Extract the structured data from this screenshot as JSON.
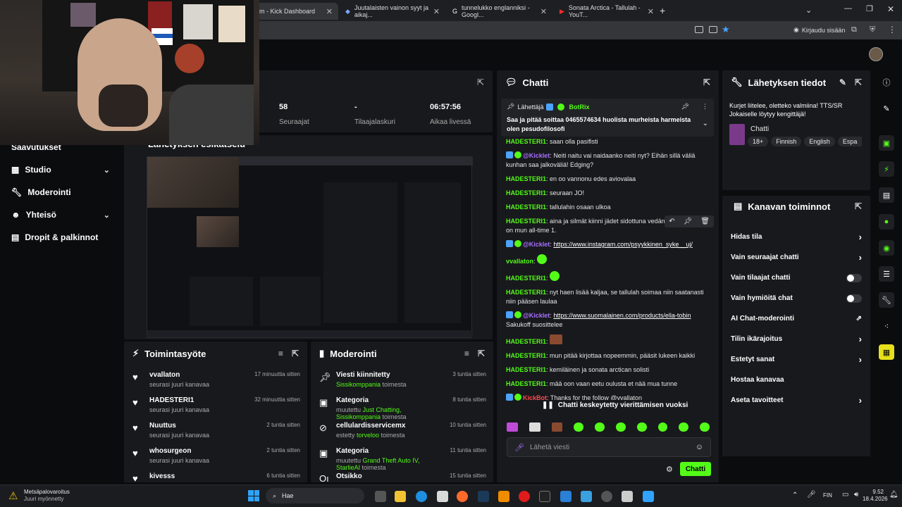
{
  "browser": {
    "tabs": [
      {
        "label": "m - Kick Dashboard",
        "active": true
      },
      {
        "label": "Juutalaisten vainon syyt ja aikaj..."
      },
      {
        "label": "tunnelukko englanniksi - Googl..."
      },
      {
        "label": "Sonata Arctica - Tallulah - YouT..."
      }
    ],
    "signin": "Kirjaudu sisään"
  },
  "stats": [
    {
      "value": "58",
      "label": "Seuraajat"
    },
    {
      "value": "-",
      "label": "Tilaajalaskuri"
    },
    {
      "value": "06:57:56",
      "label": "Aikaa livessä"
    }
  ],
  "preview_title": "Lähetyksen esikatselu",
  "sidebar": {
    "items": [
      {
        "label": "Saavutukset"
      },
      {
        "label": "Studio",
        "chev": "⌄"
      },
      {
        "label": "Moderointi"
      },
      {
        "label": "Yhteisö",
        "chev": "⌄"
      },
      {
        "label": "Dropit & palkinnot"
      }
    ]
  },
  "activity": {
    "title": "Toimintasyöte",
    "rows": [
      {
        "name": "vvallaton",
        "sub": "seurasi juuri kanavaa",
        "time": "17 minuuttia sitten"
      },
      {
        "name": "HADESTERI1",
        "sub": "seurasi juuri kanavaa",
        "time": "32 minuuttia sitten"
      },
      {
        "name": "Nuuttus",
        "sub": "seurasi juuri kanavaa",
        "time": "2 tuntia sitten"
      },
      {
        "name": "whosurgeon",
        "sub": "seurasi juuri kanavaa",
        "time": "2 tuntia sitten"
      },
      {
        "name": "kivesss",
        "sub": "",
        "time": "6 tuntia sitten"
      }
    ]
  },
  "moderation": {
    "title": "Moderointi",
    "rows": [
      {
        "name": "Viesti kiinnitetty",
        "pre": "",
        "hl": "Sissikomppania",
        "post": " toimesta",
        "time": "3 tuntia sitten"
      },
      {
        "name": "Kategoria",
        "pre": "muutettu ",
        "hl": "Just Chatting, Sissikomppania",
        "post": " toimesta",
        "time": "8 tuntia sitten"
      },
      {
        "name": "cellulardisservicemx",
        "pre": "estetty ",
        "hl": "torveloo",
        "post": " toimesta",
        "time": "10 tuntia sitten"
      },
      {
        "name": "Kategoria",
        "pre": "muutettu ",
        "hl": "Grand Theft Auto IV, StarlieAI",
        "post": " toimesta",
        "time": "11 tuntia sitten"
      },
      {
        "name": "Otsikko",
        "pre": "",
        "hl": "",
        "post": "",
        "time": "15 tuntia sitten"
      }
    ]
  },
  "chat": {
    "title": "Chatti",
    "pinned": {
      "sender_label": "Lähettäjä",
      "sender": "BotRix",
      "text": "Saa ja pitää soittaa 0465574634 huolista murheista harmeista olen pesudofilosofi"
    },
    "messages": [
      {
        "user": "HADESTERI1",
        "text": "saan olla pasifisti"
      },
      {
        "user": "@Kicklet",
        "text": "Neiti naitu vai naidaanko neiti nyt? Eihän sillä väliä kunhan saa jalkoväliä! Edging?",
        "style": "bot"
      },
      {
        "user": "HADESTERI1",
        "text": "en oo vannonu edes aviovalaa"
      },
      {
        "user": "HADESTERI1",
        "text": "seuraan JO!"
      },
      {
        "user": "HADESTERI1",
        "text": "tallulahin osaan ulkoa"
      },
      {
        "user": "HADESTERI1",
        "text": "aina ja silmät kiinni jädet sidottuna vedän s... tony kakko on mun all-time 1."
      },
      {
        "user": "@Kicklet",
        "text": "",
        "link": "https://www.instagram.com/psyykkinen_syke__uj/",
        "style": "bot"
      },
      {
        "user": "vvallaton",
        "text": "",
        "emote": true
      },
      {
        "user": "HADESTERI1",
        "text": "",
        "emote": true
      },
      {
        "user": "HADESTERI1",
        "text": "nyt haen lisää kaljaa, se tallulah soimaa niin saatanasti niin pääsen laulaa"
      },
      {
        "user": "@Kicklet",
        "text": "Sakukoff suosittelee",
        "link": "https://www.suomalainen.com/products/ella-tobin",
        "style": "bot"
      },
      {
        "user": "HADESTERI1",
        "text": "",
        "emote": true
      },
      {
        "user": "HADESTERI1",
        "text": "mun pitää kirjottaa nopeemmin, pääsit lukeen kaikki"
      },
      {
        "user": "HADESTERI1",
        "text": "kemiläinen ja sonata arctican solisti"
      },
      {
        "user": "HADESTERI1",
        "text": "mää oon vaan eetu oulusta et nää mua tunne"
      },
      {
        "user": "KickBot",
        "text": "Thanks for the follow @vvallaton",
        "style": "kickbot"
      }
    ],
    "paused": "Chatti keskeytetty vierittämisen vuoksi",
    "input_placeholder": "Lähetä viesti",
    "send_label": "Chatti"
  },
  "stream_info": {
    "title": "Lähetyksen tiedot",
    "description": "Kurjet liitelee, oletteko valmiina! TTS/SR Jokaiselle löytyy kengittäjä!",
    "category": "Chatti",
    "tags": [
      "18+",
      "Finnish",
      "English",
      "Espa"
    ]
  },
  "channel_actions": {
    "title": "Kanavan toiminnot",
    "items": [
      {
        "label": "Hidas tila",
        "kind": "arrow"
      },
      {
        "label": "Vain seuraajat chatti",
        "kind": "arrow"
      },
      {
        "label": "Vain tilaajat chatti",
        "kind": "toggle"
      },
      {
        "label": "Vain hymiöitä chat",
        "kind": "toggle"
      },
      {
        "label": "AI Chat-moderointi",
        "kind": "ext"
      },
      {
        "label": "Tilin ikärajoitus",
        "kind": "arrow"
      },
      {
        "label": "Estetyt sanat",
        "kind": "arrow"
      },
      {
        "label": "Hostaa kanavaa",
        "kind": "none"
      },
      {
        "label": "Aseta tavoitteet",
        "kind": "arrow"
      }
    ]
  },
  "taskbar": {
    "weather_title": "Metsäpalovaroitus",
    "weather_sub": "Juuri myönnetty",
    "search": "Hae",
    "lang": "FIN",
    "time": "9.52",
    "date": "18.4.2026"
  },
  "colors": {
    "accent": "#53fc18",
    "panel": "#18191d",
    "bg": "#0b0c0e",
    "mention": "#a970ff"
  }
}
